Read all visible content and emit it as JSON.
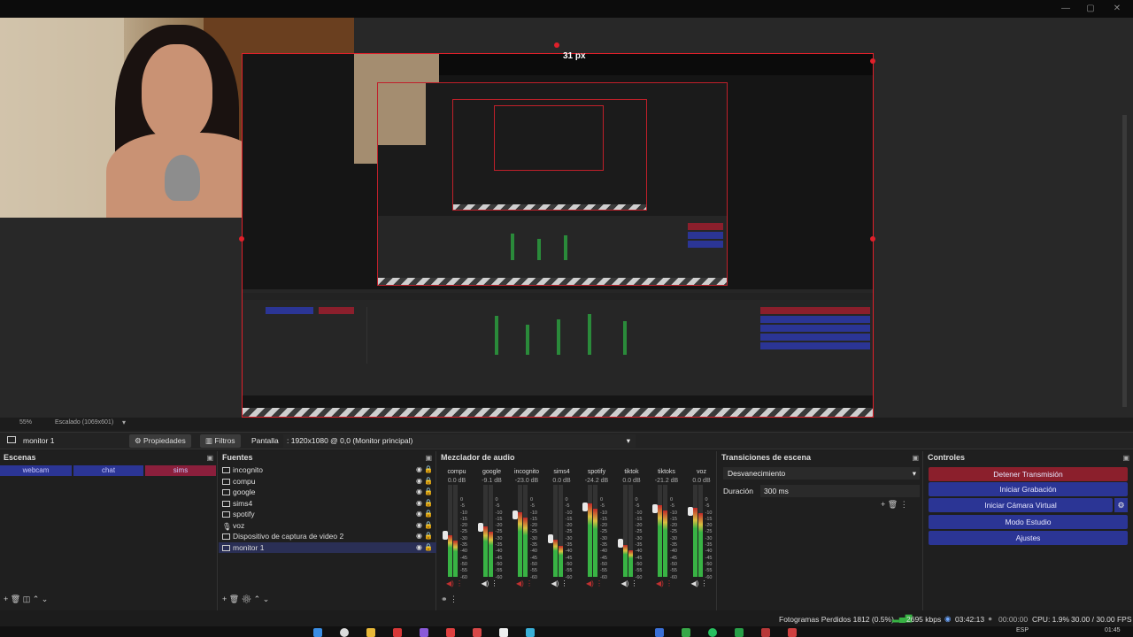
{
  "window": {
    "minimize": "—",
    "maximize": "▢",
    "close": "✕"
  },
  "preview": {
    "size_label": "31 px",
    "nested_label": "31 px"
  },
  "status_row": {
    "zoom": "55%",
    "scale": "Escalado (1069x601)"
  },
  "toolbar": {
    "source_name": "monitor 1",
    "properties_label": "Propiedades",
    "filters_label": "Filtros",
    "screen_label": "Pantalla",
    "screen_value": ": 1920x1080 @ 0,0 (Monitor principal)"
  },
  "scenes": {
    "title": "Escenas",
    "items": [
      {
        "label": "webcam",
        "color": "#2b3595"
      },
      {
        "label": "chat",
        "color": "#2b3595"
      },
      {
        "label": "sims",
        "color": "#8b1f3c"
      }
    ]
  },
  "sources": {
    "title": "Fuentes",
    "items": [
      {
        "label": "incognito",
        "icon": "window-icon"
      },
      {
        "label": "compu",
        "icon": "window-icon"
      },
      {
        "label": "google",
        "icon": "window-icon"
      },
      {
        "label": "sims4",
        "icon": "window-icon"
      },
      {
        "label": "spotify",
        "icon": "window-icon"
      },
      {
        "label": "voz",
        "icon": "mic-icon"
      },
      {
        "label": "Dispositivo de captura de video 2",
        "icon": "camera-icon"
      },
      {
        "label": "monitor 1",
        "icon": "monitor-icon"
      }
    ]
  },
  "mixer": {
    "title": "Mezclador de audio",
    "channels": [
      {
        "name": "compu",
        "db": "0.0 dB",
        "level": 0.45
      },
      {
        "name": "google",
        "db": "-9.1 dB",
        "level": 0.55
      },
      {
        "name": "incognito",
        "db": "-23.0 dB",
        "level": 0.7
      },
      {
        "name": "sims4",
        "db": "0.0 dB",
        "level": 0.4
      },
      {
        "name": "spotify",
        "db": "-24.2 dB",
        "level": 0.8
      },
      {
        "name": "tiktok",
        "db": "0.0 dB",
        "level": 0.35
      },
      {
        "name": "tiktoks",
        "db": "-21.2 dB",
        "level": 0.78
      },
      {
        "name": "voz",
        "db": "0.0 dB",
        "level": 0.75
      }
    ],
    "scale": [
      "0",
      "-5",
      "-10",
      "-15",
      "-20",
      "-25",
      "-30",
      "-35",
      "-40",
      "-45",
      "-50",
      "-55",
      "-60"
    ]
  },
  "transitions": {
    "title": "Transiciones de escena",
    "selected": "Desvanecimiento",
    "duration_label": "Duración",
    "duration_value": "300 ms"
  },
  "controls": {
    "title": "Controles",
    "stop_stream": "Detener Transmisión",
    "start_recording": "Iniciar Grabación",
    "start_virtual_cam": "Iniciar Cámara Virtual",
    "studio_mode": "Modo Estudio",
    "settings": "Ajustes",
    "colors": {
      "stop": "#8b1f2c",
      "normal": "#2b3595"
    }
  },
  "status_bar": {
    "dropped_frames": "Fotogramas Perdidos 1812 (0.5%)",
    "bitrate": "2695 kbps",
    "stream_time": "03:42:13",
    "rec_time": "00:00:00",
    "cpu": "CPU: 1.9%",
    "fps": "30.00 / 30.00 FPS"
  },
  "taskbar": {
    "lang": "ESP",
    "clock": "01:45"
  }
}
